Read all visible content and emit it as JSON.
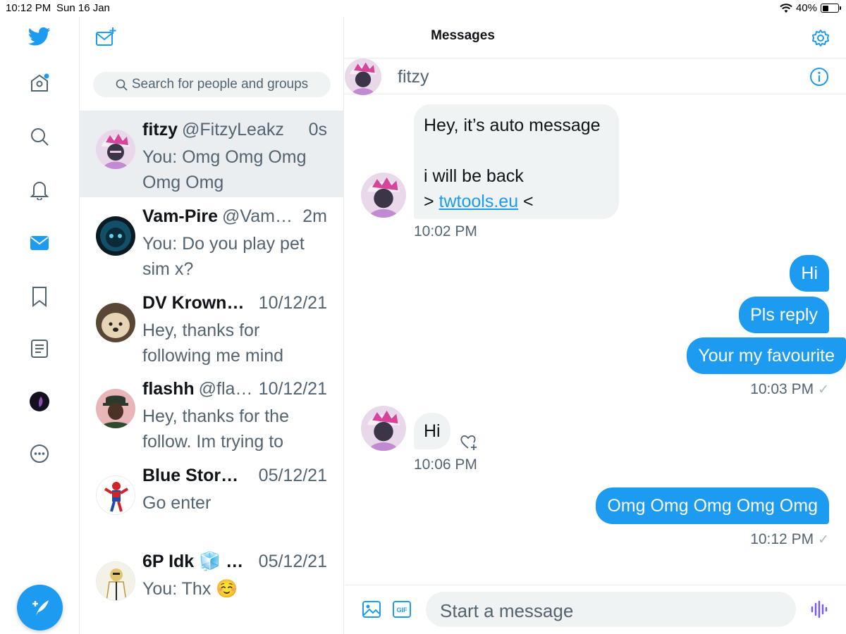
{
  "status": {
    "time": "10:12 PM",
    "date": "Sun 16 Jan",
    "battery": "40%",
    "battery_level": 0.4
  },
  "header": {
    "title": "Messages"
  },
  "search": {
    "placeholder": "Search for people and groups"
  },
  "conversations": [
    {
      "name": "fitzy",
      "handle": "@FitzyLeakz",
      "time": "0s",
      "preview": "You: Omg Omg Omg Omg Omg",
      "active": true
    },
    {
      "name": "Vam-Pire",
      "handle": "@Vam…",
      "time": "2m",
      "preview": "You: Do you play pet sim x?"
    },
    {
      "name": "DV Krown…",
      "handle": "",
      "time": "10/12/21",
      "preview": "Hey, thanks for following me mind"
    },
    {
      "name": "flashh",
      "handle": "@fla…",
      "time": "10/12/21",
      "preview": "Hey, thanks for the follow. Im trying to"
    },
    {
      "name": "Blue Stor…",
      "handle": "",
      "time": "05/12/21",
      "preview": "Go enter"
    },
    {
      "name": "6P Idk 🧊 …",
      "handle": "",
      "time": "05/12/21",
      "preview": "You: Thx ☺️"
    }
  ],
  "chat": {
    "contact_name": "fitzy",
    "messages": [
      {
        "line1": "Hey, it’s auto message",
        "line2": "i will be back",
        "line3_prefix": "> ",
        "link": "twtools.eu",
        "line3_suffix": " <",
        "time": "10:02 PM"
      },
      {
        "text": "Hi"
      },
      {
        "text": "Pls reply"
      },
      {
        "text": "Your my favourite",
        "time": "10:03 PM"
      },
      {
        "text": "Hi",
        "time": "10:06 PM"
      },
      {
        "text": "Omg Omg Omg Omg Omg",
        "time": "10:12 PM"
      }
    ],
    "composer_placeholder": "Start a message",
    "check": "✓"
  },
  "colors": {
    "accent": "#1d9bf0",
    "muted": "#536471",
    "bubble_in": "#eff3f4",
    "voice": "#7856ff"
  }
}
